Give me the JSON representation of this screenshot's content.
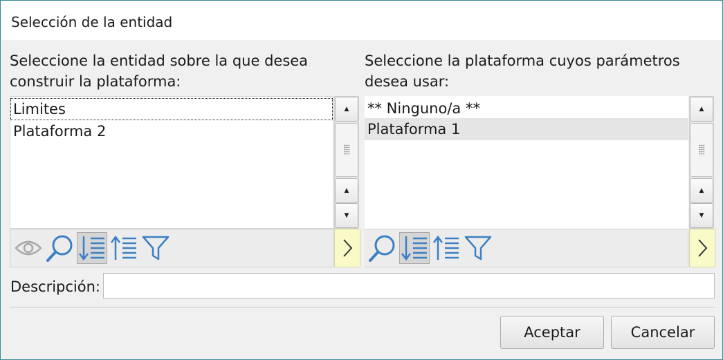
{
  "window": {
    "title": "Selección de la entidad"
  },
  "left_panel": {
    "prompt": "Seleccione la entidad sobre la que desea construir la plataforma:",
    "items": [
      {
        "label": "Limites",
        "focused": true
      },
      {
        "label": "Plataforma 2"
      }
    ],
    "toolbar": [
      {
        "icon": "eye-icon",
        "state": "disabled"
      },
      {
        "icon": "search-icon"
      },
      {
        "icon": "sort-descending-icon",
        "state": "pressed"
      },
      {
        "icon": "sort-ascending-icon"
      },
      {
        "icon": "filter-icon"
      }
    ],
    "next_icon": "chevron-right-icon"
  },
  "right_panel": {
    "prompt": "Seleccione la plataforma cuyos parámetros desea usar:",
    "items": [
      {
        "label": "** Ninguno/a **"
      },
      {
        "label": "Plataforma 1",
        "selected": true
      }
    ],
    "toolbar": [
      {
        "icon": "search-icon"
      },
      {
        "icon": "sort-descending-icon",
        "state": "pressed"
      },
      {
        "icon": "sort-ascending-icon"
      },
      {
        "icon": "filter-icon"
      }
    ],
    "next_icon": "chevron-right-icon"
  },
  "description": {
    "label": "Descripción:",
    "value": ""
  },
  "buttons": {
    "accept": "Aceptar",
    "cancel": "Cancelar"
  },
  "colors": {
    "icon_blue": "#3b7fc4",
    "icon_disabled": "#a8a8a8",
    "next_button_bg": "#fafac8",
    "selection_bg": "#e5e5e5",
    "window_border": "#3a8a9a"
  }
}
